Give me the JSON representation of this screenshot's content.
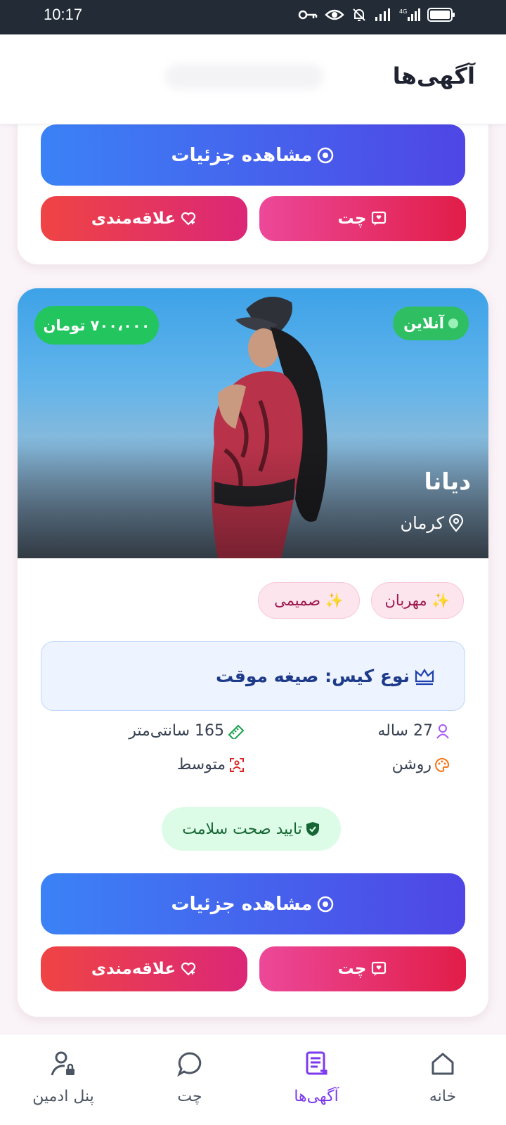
{
  "status_bar": {
    "time": "10:17"
  },
  "header": {
    "title": "آگهی‌ها"
  },
  "card_top": {
    "details_label": "مشاهده جزئیات",
    "chat_label": "چت",
    "favorite_label": "علاقه‌مندی"
  },
  "card": {
    "price": "۷۰۰،۰۰۰ تومان",
    "online": "آنلاین",
    "name": "دیانا",
    "city": "کرمان",
    "tags": [
      "✨ مهربان",
      "✨ صمیمی"
    ],
    "case_type": "نوع کیس: صیغه موقت",
    "age": "27 ساله",
    "height": "165 سانتی‌متر",
    "skin": "روشن",
    "body": "متوسط",
    "health": "تایید صحت سلامت",
    "details_label": "مشاهده جزئیات",
    "chat_label": "چت",
    "favorite_label": "علاقه‌مندی"
  },
  "nav": {
    "home": "خانه",
    "ads": "آگهی‌ها",
    "chat": "چت",
    "admin": "پنل ادمین"
  },
  "colors": {
    "accent": "#7c3aed",
    "details_gradient": [
      "#3b82f6",
      "#4f46e5"
    ],
    "chat_gradient": [
      "#ec4899",
      "#e11d48"
    ],
    "favorite_gradient": [
      "#ef4444",
      "#db2777"
    ],
    "price_badge": "#22c55e",
    "case_box": "#eef4ff"
  }
}
